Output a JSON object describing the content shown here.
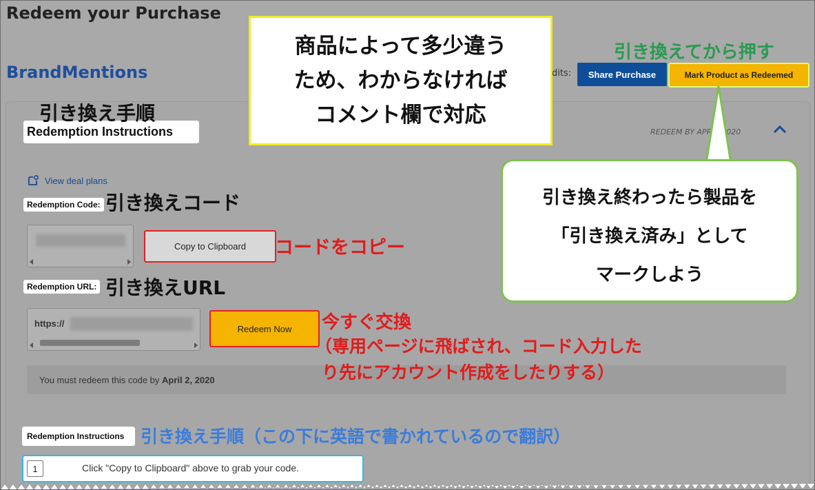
{
  "page": {
    "title": "Redeem your Purchase",
    "brand": "BrandMentions",
    "credits_label": "dits:"
  },
  "header_buttons": {
    "share": "Share Purchase",
    "mark_redeemed": "Mark Product as Redeemed"
  },
  "card": {
    "section_title": "Redemption Instructions",
    "redeem_by": "REDEEM BY APR 2 2020",
    "view_deal_plans": "View deal plans",
    "code_label": "Redemption Code:",
    "copy_button": "Copy to Clipboard",
    "url_label": "Redemption URL:",
    "url_prefix": "https://",
    "redeem_button": "Redeem Now",
    "notice_prefix": "You must redeem this code by ",
    "notice_date": "April 2, 2020",
    "instructions_title": "Redemption Instructions",
    "steps": [
      {
        "num": "1",
        "text": "Click \"Copy to Clipboard\" above to grab your code."
      }
    ]
  },
  "annotations": {
    "top_callout": [
      "商品によって多少違う",
      "ため、わからなければ",
      "コメント欄で対応"
    ],
    "right_callout": [
      "引き換え終わったら製品を",
      "「引き換え済み」として",
      "マークしよう"
    ],
    "mark_after": "引き換えてから押す",
    "steps_heading": "引き換え手順",
    "code_heading": "引き換えコード",
    "copy_code": "コードをコピー",
    "url_heading": "引き換えURL",
    "redeem_now": "今すぐ交換",
    "redeem_note_line1": "（専用ページに飛ばされ、コード入力した",
    "redeem_note_line2": "り先にアカウント作成をしたりする）",
    "translation_note": "引き換え手順（この下に英語で書かれているので翻訳）"
  },
  "colors": {
    "brand_blue": "#1f4e9c",
    "share_button": "#0e4e98",
    "accent_yellow": "#f5b400",
    "highlight_red": "#e42020",
    "annotation_green": "#2a9a52",
    "annotation_blue": "#3b7ddb"
  },
  "icons": {
    "deal_plans": "external-doc-icon",
    "collapse": "chevron-up-icon"
  }
}
